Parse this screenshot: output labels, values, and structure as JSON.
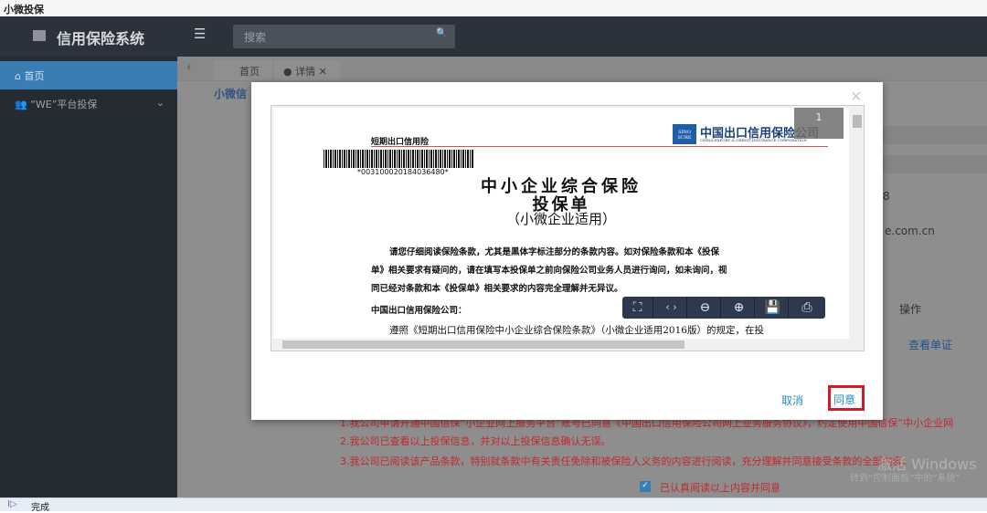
{
  "window": {
    "title": "小微投保"
  },
  "header": {
    "app_title": "信用保险系统",
    "search_placeholder": "搜索"
  },
  "sidebar": {
    "items": [
      {
        "label": "首页"
      },
      {
        "label": "“WE”平台投保"
      }
    ]
  },
  "tabs": [
    {
      "label": "首页"
    },
    {
      "label": "详情"
    }
  ],
  "content": {
    "heading": "小微信",
    "partial_value_1": "8",
    "partial_value_2": "e.com.cn",
    "col_action": "操作",
    "link_view": "查看单证",
    "terms": [
      "1.我公司申请开通中国信保“小企业网上服务平台”账号已同意《中国出口信用保险公司网上业务服务协议》，约定使用中国信保“中小企业网",
      "2.我公司已查看以上投保信息，并对以上投保信息确认无误。",
      "3.我公司已阅读该产品条款，特别就条款中有关责任免除和被保险人义务的内容进行阅读，充分理解并同意接受条款的全部内容。"
    ],
    "checkbox_label": "已认真阅读以上内容并同意",
    "checkbox_checked": true
  },
  "watermark": {
    "line1": "激活 Windows",
    "line2": "转到“控制面板”中的“系统”"
  },
  "modal": {
    "page_number": "1",
    "document": {
      "header_left": "短期出口信用险",
      "company_cn": "中国出口信用保险公司",
      "company_en": "CHINA EXPORT & CREDIT INSURANCE CORPORATION",
      "logo_text": "SINOSURE",
      "barcode": "*003100020184036480*",
      "title1": "中小企业综合保险",
      "title2": "投保单",
      "title3": "（小微企业适用）",
      "para1": "请您仔细阅读保险条款，尤其是黑体字标注部分的条款内容。如对保险条款和本《投保",
      "para2": "单》相关要求有疑问的，请在填写本投保单之前向保险公司业务人员进行询问，如未询问，视",
      "para3": "同已经对条款和本《投保单》相关要求的内容完全理解并无异议。",
      "addressee": "中国出口信用保险公司：",
      "para4": "遵照《短期出口信用保险中小企业综合保险条款》（小微企业适用2016版）的规定，在投"
    },
    "toolbar": [
      "fit-page",
      "fit-width",
      "zoom-out",
      "zoom-in",
      "save",
      "print"
    ],
    "cancel_label": "取消",
    "agree_label": "同意"
  },
  "status": {
    "text": "完成"
  }
}
